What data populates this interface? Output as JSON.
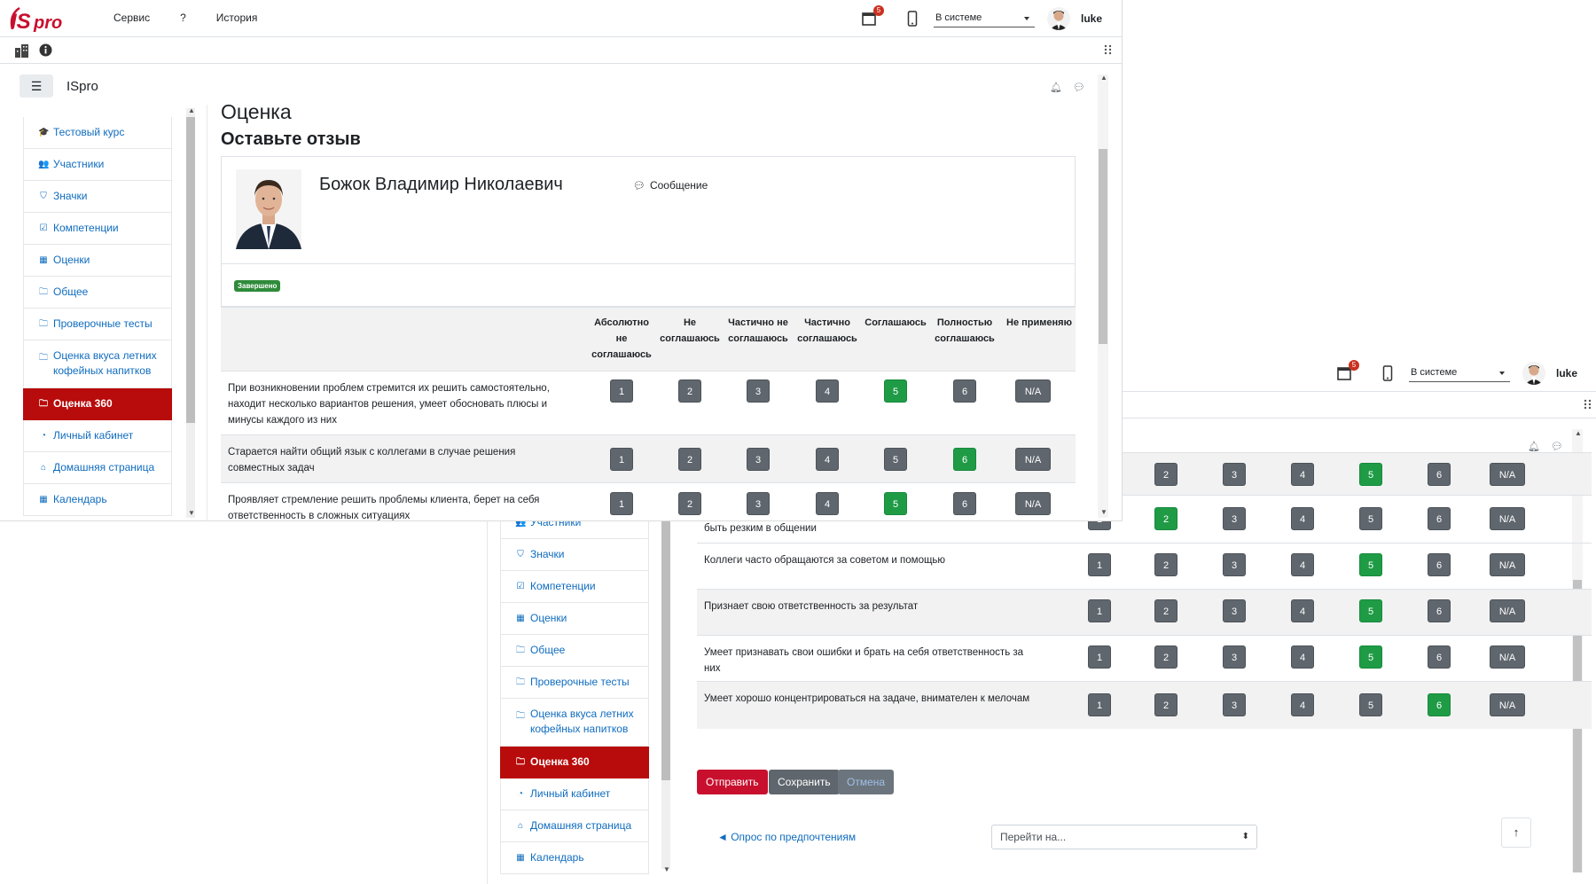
{
  "nav": {
    "menu": [
      "Сервис",
      "?",
      "История"
    ],
    "notifications_count": "5",
    "status_value": "В системе",
    "username": "luke"
  },
  "course": {
    "site_name": "ISpro"
  },
  "sidebar": {
    "items": [
      {
        "label": "Тестовый курс",
        "icon": "graduation-cap-icon",
        "glyph": "🎓"
      },
      {
        "label": "Участники",
        "icon": "users-icon",
        "glyph": "👥"
      },
      {
        "label": "Значки",
        "icon": "shield-icon",
        "glyph": "⛉"
      },
      {
        "label": "Компетенции",
        "icon": "check-square-icon",
        "glyph": "☑"
      },
      {
        "label": "Оценки",
        "icon": "table-icon",
        "glyph": "▦"
      },
      {
        "label": "Общее",
        "icon": "folder-icon",
        "glyph": "🗀"
      },
      {
        "label": "Проверочные тесты",
        "icon": "folder-icon",
        "glyph": "🗀"
      },
      {
        "label": "Оценка вкуса летних кофейных напитков",
        "icon": "folder-icon",
        "glyph": "🗀"
      },
      {
        "label": "Оценка 360",
        "icon": "folder-icon",
        "glyph": "🗀"
      },
      {
        "label": "Личный кабинет",
        "icon": "dashboard-icon",
        "glyph": "◔"
      },
      {
        "label": "Домашняя страница",
        "icon": "home-icon",
        "glyph": "⌂"
      },
      {
        "label": "Календарь",
        "icon": "calendar-icon",
        "glyph": "▦"
      }
    ]
  },
  "page": {
    "title": "Оценка",
    "subtitle": "Оставьте отзыв",
    "person_name": "Божок Владимир Николаевич",
    "message_label": "Сообщение",
    "status_badge": "Завершено"
  },
  "table": {
    "headers": [
      "Абсолютно не соглашаюсь",
      "Не соглашаюсь",
      "Частично не соглашаюсь",
      "Частично соглашаюсь",
      "Соглашаюсь",
      "Полностью соглашаюсь",
      "Не применяю"
    ],
    "options": [
      "1",
      "2",
      "3",
      "4",
      "5",
      "6",
      "N/A"
    ],
    "front_rows": [
      {
        "text": "При возникновении проблем стремится их решить самостоятельно, находит несколько вариантов решения, умеет обосновать плюсы и минусы каждого из них",
        "selected": 4
      },
      {
        "text": "Старается найти общий язык с коллегами в случае решения совместных задач",
        "selected": 5
      },
      {
        "text": "Проявляет стремление решить проблемы клиента, берет на себя ответственность в сложных ситуациях",
        "selected": 4
      }
    ],
    "back_rows": [
      {
        "text": "",
        "selected": 4
      },
      {
        "text": "В сложных коммуникативных ситуациях легко раздражается, может быть резким в общении",
        "selected": 1
      },
      {
        "text": "Коллеги часто обращаются за советом и помощью",
        "selected": 4
      },
      {
        "text": "Признает свою ответственность за результат",
        "selected": 4
      },
      {
        "text": "Умеет признавать свои ошибки и брать на себя ответственность за них",
        "selected": 4
      },
      {
        "text": "Умеет хорошо концентрироваться на задаче, внимателен к мелочам",
        "selected": 5
      }
    ]
  },
  "actions": {
    "submit": "Отправить",
    "save": "Сохранить",
    "cancel": "Отмена",
    "prev_link": "◄ Опрос по предпочтениям",
    "jump_placeholder": "Перейти на..."
  },
  "colors": {
    "brand_red": "#b80b0b",
    "selected_green": "#1f9b46",
    "option_gray": "#5f666d",
    "link_blue": "#0f6cbf"
  }
}
